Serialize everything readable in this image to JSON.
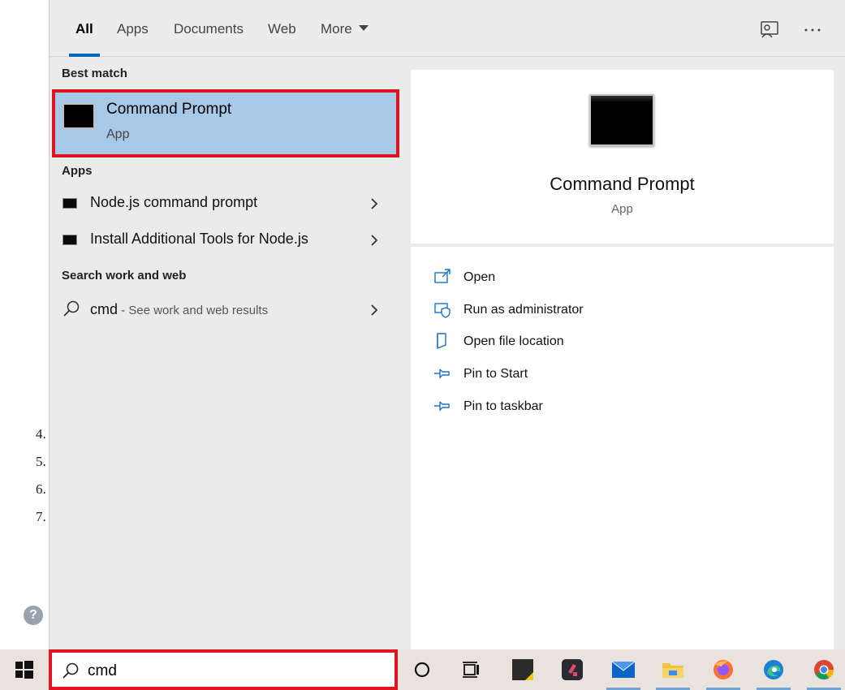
{
  "background": {
    "list_numbers": [
      "4.",
      "5.",
      "6.",
      "7."
    ],
    "help_glyph": "?"
  },
  "tabs": [
    {
      "label": "All",
      "active": true
    },
    {
      "label": "Apps"
    },
    {
      "label": "Documents"
    },
    {
      "label": "Web"
    },
    {
      "label": "More"
    }
  ],
  "top_icons": [
    "feedback-icon",
    "more-options-icon"
  ],
  "left": {
    "best_match_title": "Best match",
    "best_match": {
      "title": "Command Prompt",
      "subtitle": "App",
      "icon": "command-prompt-icon"
    },
    "apps_title": "Apps",
    "apps": [
      {
        "label": "Node.js command prompt",
        "icon": "terminal-icon"
      },
      {
        "label": "Install Additional Tools for Node.js",
        "icon": "terminal-icon"
      }
    ],
    "web_title": "Search work and web",
    "web_result": {
      "query": "cmd",
      "suffix": " - See work and web results"
    }
  },
  "right": {
    "title": "Command Prompt",
    "subtitle": "App",
    "actions": [
      {
        "label": "Open",
        "icon": "open-icon"
      },
      {
        "label": "Run as administrator",
        "icon": "shield-icon"
      },
      {
        "label": "Open file location",
        "icon": "file-location-icon"
      },
      {
        "label": "Pin to Start",
        "icon": "pin-icon"
      },
      {
        "label": "Pin to taskbar",
        "icon": "pin-icon"
      }
    ]
  },
  "taskbar": {
    "search_value": "cmd",
    "items": [
      "cortana-icon",
      "task-view-icon",
      "sticky-notes-icon",
      "media-app-icon",
      "mail-icon",
      "file-explorer-icon",
      "firefox-icon",
      "edge-icon",
      "chrome-icon"
    ]
  },
  "colors": {
    "accent": "#0067c0",
    "highlight": "#a8c8e8",
    "annotation_red": "#e0141e"
  }
}
